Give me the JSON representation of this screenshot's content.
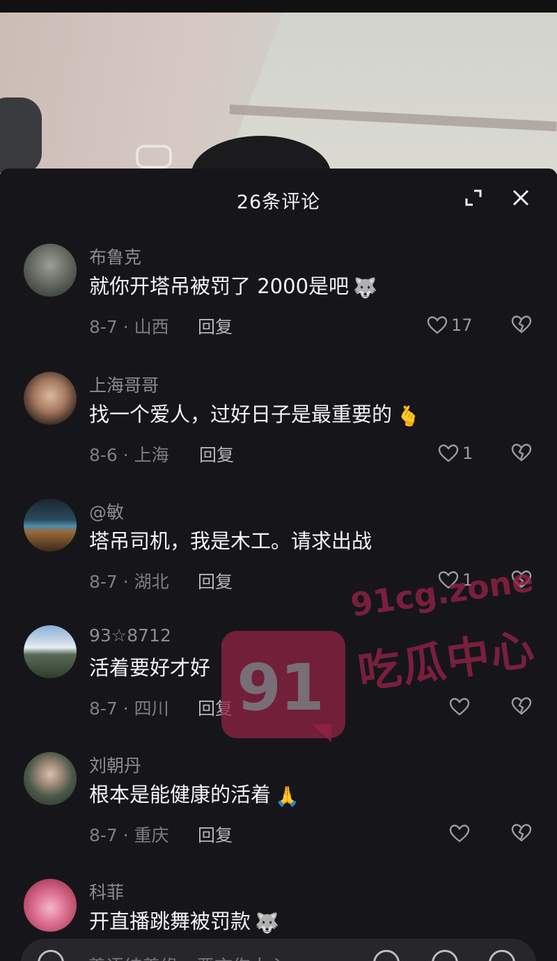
{
  "header": {
    "title": "26条评论"
  },
  "comments": [
    {
      "user": "布鲁克",
      "text": "就你开塔吊被罚了 2000是吧",
      "emoji": "🐺",
      "meta": "8-7 · 山西",
      "reply": "回复",
      "likes": "17"
    },
    {
      "user": "上海哥哥",
      "text": "找一个爱人，过好日子是最重要的",
      "emoji": "🫰",
      "meta": "8-6 · 上海",
      "reply": "回复",
      "likes": "1"
    },
    {
      "user": "@敏",
      "text": "塔吊司机，我是木工。请求出战",
      "emoji": "",
      "meta": "8-7 · 湖北",
      "reply": "回复",
      "likes": "1"
    },
    {
      "user": "93☆8712",
      "text": "活着要好才好",
      "emoji": "",
      "meta": "8-7 · 四川",
      "reply": "回复",
      "likes": ""
    },
    {
      "user": "刘朝丹",
      "text": "根本是能健康的活着",
      "emoji": "🙏",
      "meta": "8-7 · 重庆",
      "reply": "回复",
      "likes": ""
    },
    {
      "user": "科菲",
      "text": "开直播跳舞被罚款",
      "emoji": "🐺",
      "meta": "",
      "reply": "",
      "likes": ""
    }
  ],
  "watermark": {
    "number": "91",
    "domain": "91cg.zone",
    "name": "吃瓜中心"
  },
  "input": {
    "placeholder": "善语结善缘，恶言伤人心"
  },
  "colors": {
    "sheet_bg": "#16161a",
    "text_primary": "#f4f4f6",
    "text_secondary": "#8c8c91",
    "watermark": "#962346"
  }
}
